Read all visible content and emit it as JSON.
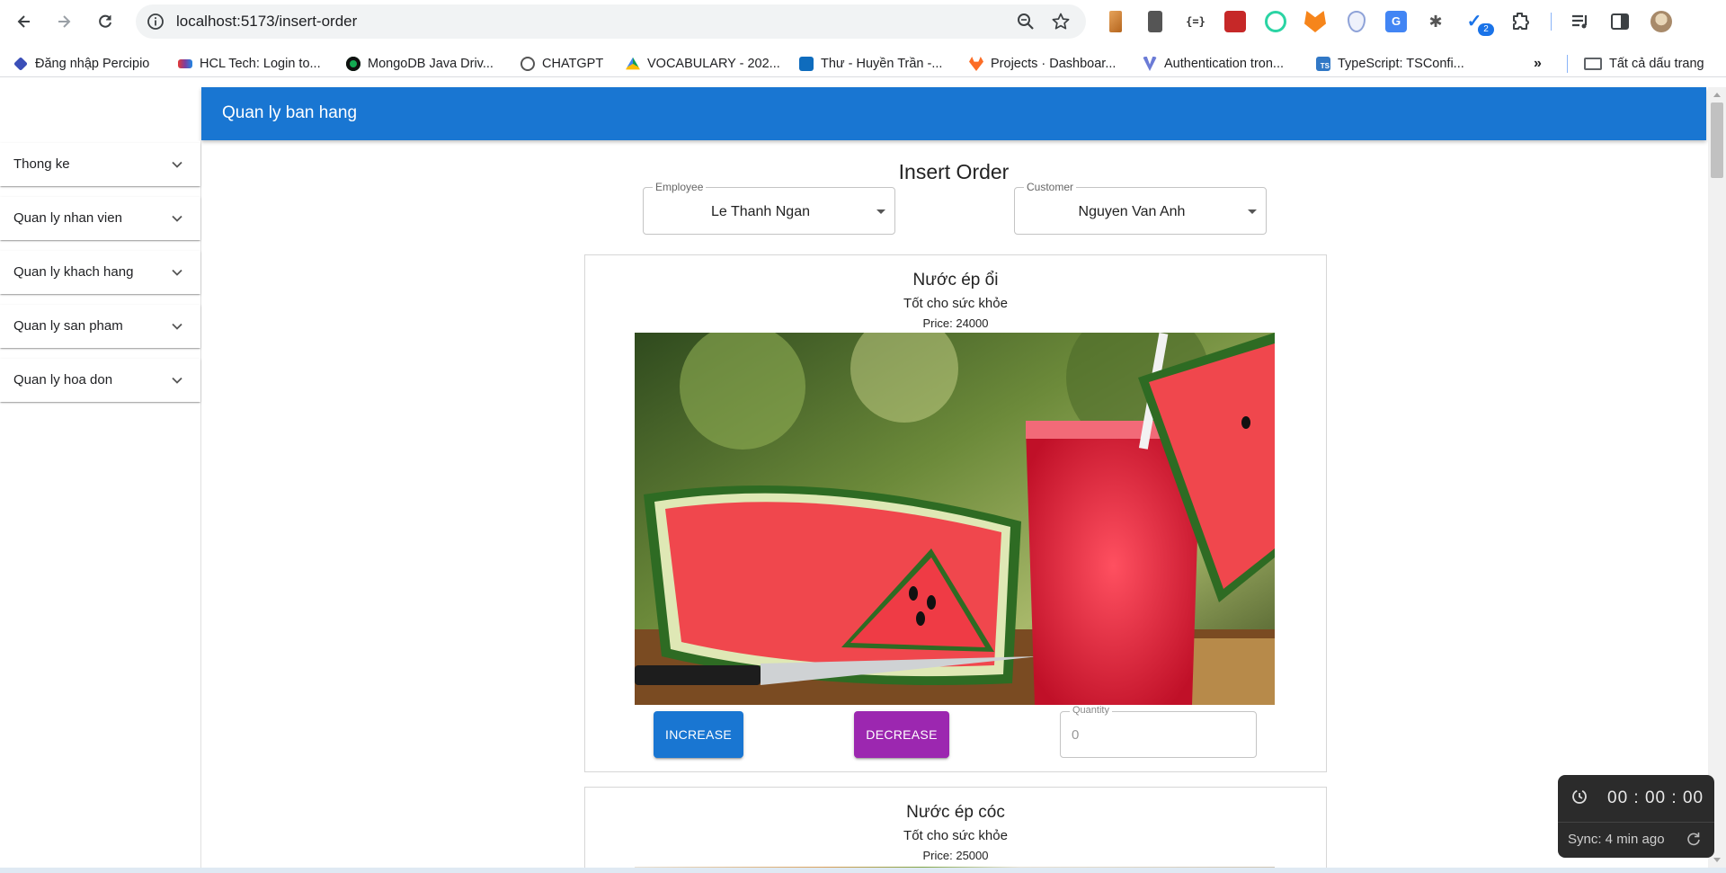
{
  "browser": {
    "url": "localhost:5173/insert-order",
    "extension_badge": "2",
    "bookmarks": [
      {
        "label": "Đăng nhập Percipio",
        "icon": "percipio-icon",
        "color": "#3b4fb8"
      },
      {
        "label": "HCL Tech: Login to...",
        "icon": "hcl-icon",
        "color": "#7b3fa0"
      },
      {
        "label": "MongoDB Java Driv...",
        "icon": "mongodb-icon",
        "color": "#13aa52"
      },
      {
        "label": "CHATGPT",
        "icon": "chatgpt-icon",
        "color": "#10a37f"
      },
      {
        "label": "VOCABULARY - 202...",
        "icon": "google-drive-icon",
        "color": "#fbbc04"
      },
      {
        "label": "Thư - Huyền Trần -...",
        "icon": "outlook-icon",
        "color": "#0f6cbd"
      },
      {
        "label": "Projects · Dashboar...",
        "icon": "gitlab-icon",
        "color": "#fc6d26"
      },
      {
        "label": "Authentication tron...",
        "icon": "vue-icon",
        "color": "#6b7bd6"
      },
      {
        "label": "TypeScript: TSConfi...",
        "icon": "typescript-icon",
        "color": "#3178c6"
      }
    ],
    "all_bookmarks_label": "Tất cả dấu trang"
  },
  "app": {
    "title": "Quan ly ban hang"
  },
  "sidebar": {
    "items": [
      {
        "label": "Thong ke"
      },
      {
        "label": "Quan ly nhan vien"
      },
      {
        "label": "Quan ly khach hang"
      },
      {
        "label": "Quan ly san pham"
      },
      {
        "label": "Quan ly hoa don"
      }
    ]
  },
  "main": {
    "title": "Insert Order",
    "employee": {
      "label": "Employee",
      "value": "Le Thanh Ngan"
    },
    "customer": {
      "label": "Customer",
      "value": "Nguyen Van Anh"
    },
    "products": [
      {
        "name": "Nước ép ổi",
        "description": "Tốt cho sức khỏe",
        "price": "Price: 24000",
        "increase_label": "INCREASE",
        "decrease_label": "DECREASE",
        "quantity_label": "Quantity",
        "quantity": "0"
      },
      {
        "name": "Nước ép cóc",
        "description": "Tốt cho sức khỏe",
        "price": "Price: 25000"
      }
    ]
  },
  "timer": {
    "time": "00 : 00 : 00",
    "sync": "Sync: 4 min ago"
  },
  "colors": {
    "appbar": "#1976d2",
    "increase": "#1976d2",
    "decrease": "#9c27b0"
  }
}
